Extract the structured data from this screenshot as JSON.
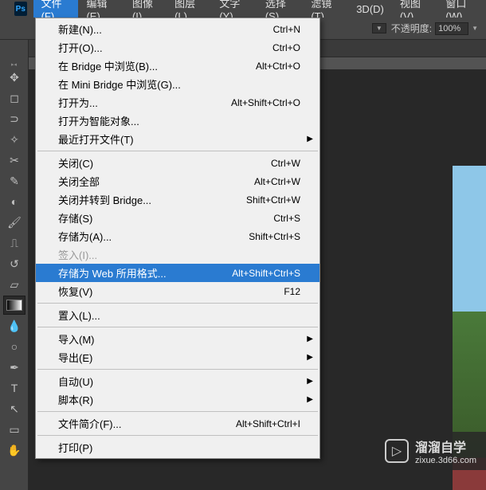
{
  "app_logo": "Ps",
  "menubar": [
    {
      "label": "文件(F)",
      "active": true
    },
    {
      "label": "编辑(E)"
    },
    {
      "label": "图像(I)"
    },
    {
      "label": "图层(L)"
    },
    {
      "label": "文字(Y)"
    },
    {
      "label": "选择(S)"
    },
    {
      "label": "滤镜(T)"
    },
    {
      "label": "3D(D)"
    },
    {
      "label": "视图(V)"
    },
    {
      "label": "窗口(W)"
    }
  ],
  "options": {
    "opacity_label": "不透明度:",
    "opacity_value": "100%"
  },
  "file_menu": [
    {
      "label": "新建(N)...",
      "shortcut": "Ctrl+N"
    },
    {
      "label": "打开(O)...",
      "shortcut": "Ctrl+O"
    },
    {
      "label": "在 Bridge 中浏览(B)...",
      "shortcut": "Alt+Ctrl+O"
    },
    {
      "label": "在 Mini Bridge 中浏览(G)..."
    },
    {
      "label": "打开为...",
      "shortcut": "Alt+Shift+Ctrl+O"
    },
    {
      "label": "打开为智能对象..."
    },
    {
      "label": "最近打开文件(T)",
      "submenu": true
    },
    {
      "separator": true
    },
    {
      "label": "关闭(C)",
      "shortcut": "Ctrl+W"
    },
    {
      "label": "关闭全部",
      "shortcut": "Alt+Ctrl+W"
    },
    {
      "label": "关闭并转到 Bridge...",
      "shortcut": "Shift+Ctrl+W"
    },
    {
      "label": "存储(S)",
      "shortcut": "Ctrl+S"
    },
    {
      "label": "存储为(A)...",
      "shortcut": "Shift+Ctrl+S"
    },
    {
      "label": "签入(I)...",
      "disabled": true
    },
    {
      "label": "存储为 Web 所用格式...",
      "shortcut": "Alt+Shift+Ctrl+S",
      "highlighted": true
    },
    {
      "label": "恢复(V)",
      "shortcut": "F12"
    },
    {
      "separator": true
    },
    {
      "label": "置入(L)..."
    },
    {
      "separator": true
    },
    {
      "label": "导入(M)",
      "submenu": true
    },
    {
      "label": "导出(E)",
      "submenu": true
    },
    {
      "separator": true
    },
    {
      "label": "自动(U)",
      "submenu": true
    },
    {
      "label": "脚本(R)",
      "submenu": true
    },
    {
      "separator": true
    },
    {
      "label": "文件简介(F)...",
      "shortcut": "Alt+Shift+Ctrl+I"
    },
    {
      "separator": true
    },
    {
      "label": "打印(P)"
    }
  ],
  "watermark": {
    "title": "溜溜自学",
    "url": "zixue.3d66.com"
  }
}
